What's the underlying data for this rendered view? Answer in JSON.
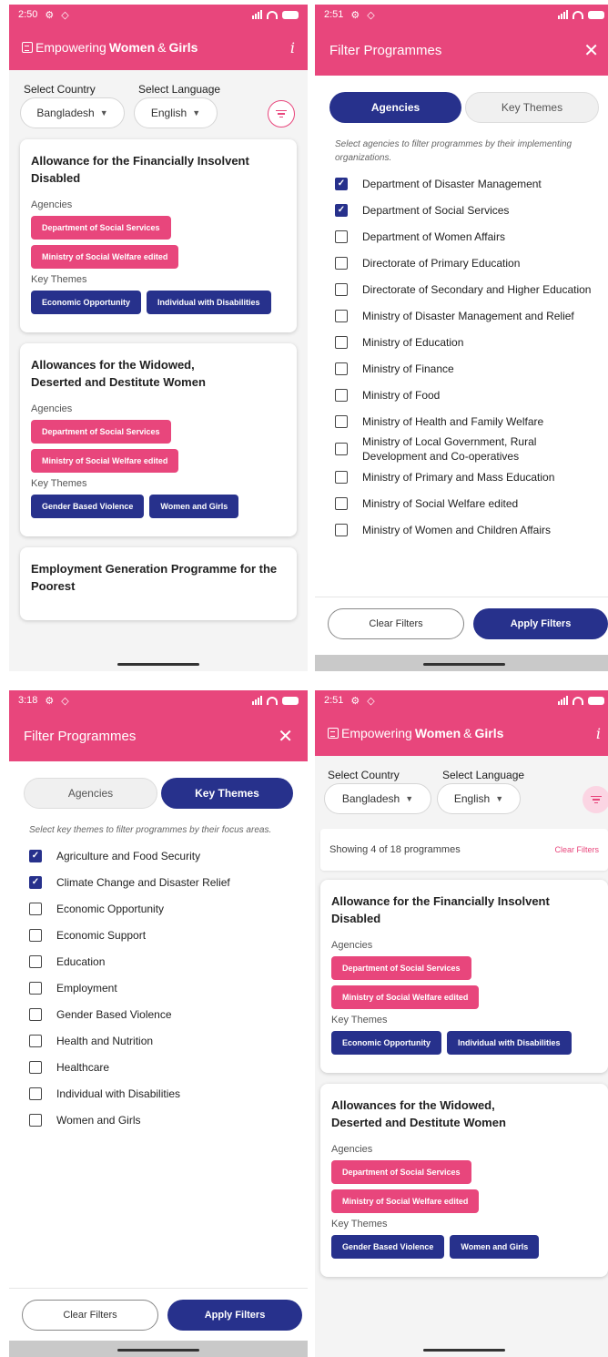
{
  "app": {
    "logo_regular": "Empowering",
    "logo_bold": "Women",
    "logo_amp": "&",
    "logo_bold2": "Girls",
    "info_glyph": "i",
    "select_country_label": "Select Country",
    "select_language_label": "Select Language",
    "country_value": "Bangladesh",
    "language_value": "English",
    "agencies_label": "Agencies",
    "key_themes_label": "Key Themes"
  },
  "screens": [
    {
      "status_time": "2:50"
    },
    {
      "status_time": "2:51"
    },
    {
      "status_time": "3:18"
    },
    {
      "status_time": "2:51"
    }
  ],
  "programmes": [
    {
      "title": "Allowance for the Financially Insolvent Disabled",
      "agencies": [
        "Department of Social Services",
        "Ministry of Social Welfare edited"
      ],
      "themes": [
        "Economic Opportunity",
        "Individual with Disabilities"
      ]
    },
    {
      "title": "Allowances for the Widowed,\nDeserted and Destitute Women",
      "agencies": [
        "Department of Social Services",
        "Ministry of Social Welfare edited"
      ],
      "themes": [
        "Gender Based Violence",
        "Women and Girls"
      ]
    },
    {
      "title": "Employment Generation Programme for the Poorest"
    }
  ],
  "filter": {
    "title": "Filter Programmes",
    "close_glyph": "✕",
    "tab_agencies": "Agencies",
    "tab_key_themes": "Key Themes",
    "agencies_hint": "Select agencies to filter programmes by their implementing organizations.",
    "themes_hint": "Select key themes to filter programmes by their focus areas.",
    "clear_label": "Clear Filters",
    "apply_label": "Apply Filters",
    "agencies": [
      {
        "label": "Department of Disaster Management",
        "checked": true
      },
      {
        "label": "Department of Social Services",
        "checked": true
      },
      {
        "label": "Department of Women Affairs",
        "checked": false
      },
      {
        "label": "Directorate of Primary Education",
        "checked": false
      },
      {
        "label": "Directorate of Secondary and Higher Education",
        "checked": false
      },
      {
        "label": "Ministry of Disaster Management and Relief",
        "checked": false
      },
      {
        "label": "Ministry of Education",
        "checked": false
      },
      {
        "label": "Ministry of Finance",
        "checked": false
      },
      {
        "label": "Ministry of Food",
        "checked": false
      },
      {
        "label": "Ministry of Health and Family Welfare",
        "checked": false
      },
      {
        "label": "Ministry of Local Government, Rural Development and Co-operatives",
        "checked": false
      },
      {
        "label": "Ministry of Primary and Mass Education",
        "checked": false
      },
      {
        "label": "Ministry of Social Welfare edited",
        "checked": false
      },
      {
        "label": "Ministry of Women and Children Affairs",
        "checked": false
      }
    ],
    "themes": [
      {
        "label": "Agriculture and Food Security",
        "checked": true
      },
      {
        "label": "Climate Change and Disaster Relief",
        "checked": true
      },
      {
        "label": "Economic Opportunity",
        "checked": false
      },
      {
        "label": "Economic Support",
        "checked": false
      },
      {
        "label": "Education",
        "checked": false
      },
      {
        "label": "Employment",
        "checked": false
      },
      {
        "label": "Gender Based Violence",
        "checked": false
      },
      {
        "label": "Health and Nutrition",
        "checked": false
      },
      {
        "label": "Healthcare",
        "checked": false
      },
      {
        "label": "Individual with Disabilities",
        "checked": false
      },
      {
        "label": "Women and Girls",
        "checked": false
      }
    ]
  },
  "results": {
    "showing_text": "Showing 4 of 18 programmes",
    "clear_label": "Clear Filters"
  },
  "colors": {
    "brand_pink": "#e8467c",
    "navy": "#27318c"
  }
}
